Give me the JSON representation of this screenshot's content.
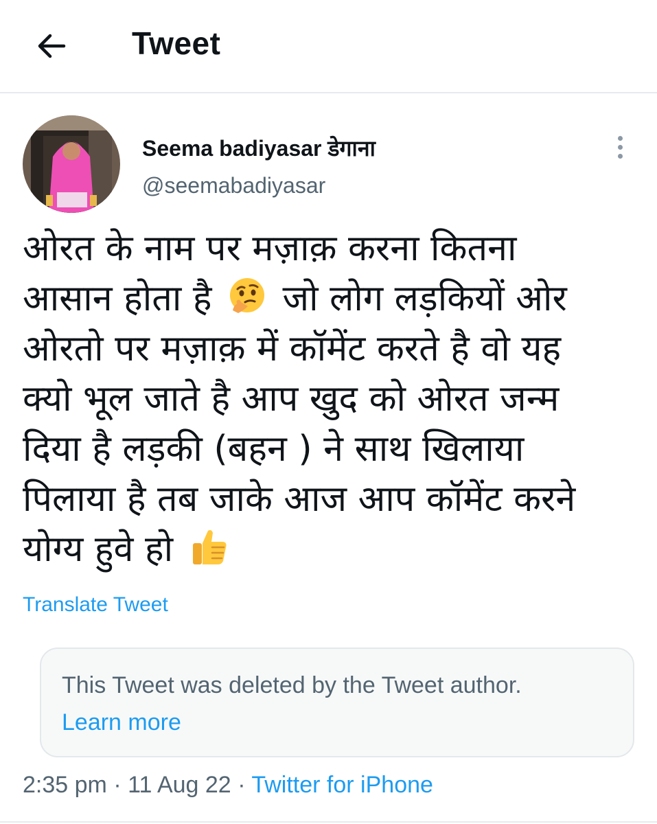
{
  "header": {
    "title": "Tweet",
    "back_icon": "arrow-left-icon"
  },
  "author": {
    "display_name": "Seema badiyasar डेगाना",
    "handle": "@seemabadiyasar",
    "more_icon": "more-vertical-icon"
  },
  "tweet": {
    "lines": [
      "ओरत के नाम पर मज़ाक़ करना कितना",
      "आसान होता है",
      "जो लोग लड़कियों ओर",
      "ओरतो पर मज़ाक़ में कॉमेंट करते है वो यह",
      "क्यो भूल जाते है आप खुद को ओरत जन्म",
      "दिया है लड़की (बहन ) ने साथ खिलाया",
      "पिलाया है तब जाके आज आप कॉमेंट करने",
      "योग्य हुवे हो"
    ],
    "emoji_1": "thinking-face-emoji",
    "emoji_2": "thumbs-up-emoji",
    "translate_label": "Translate Tweet"
  },
  "quoted": {
    "deleted_message": "This Tweet was deleted by the Tweet author.",
    "learn_more_label": "Learn more"
  },
  "meta": {
    "time": "2:35 pm",
    "separator": "·",
    "date": "11 Aug 22",
    "source": "Twitter for iPhone"
  },
  "colors": {
    "accent": "#1d9bf0",
    "secondary_text": "#536471",
    "primary_text": "#0f1419",
    "divider": "#e7eaed"
  }
}
